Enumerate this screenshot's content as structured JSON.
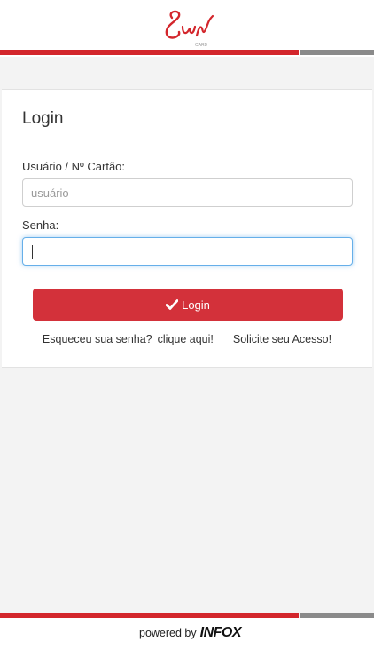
{
  "brand": {
    "name": "Sun",
    "sub": "CARD",
    "red": "#d3262c",
    "grey": "#8a8a8a"
  },
  "login": {
    "title": "Login",
    "user_label": "Usuário / Nº Cartão:",
    "user_placeholder": "usuário",
    "user_value": "",
    "password_label": "Senha:",
    "password_value": "",
    "button_label": "Login",
    "button_icon": "check-icon"
  },
  "links": {
    "forgot_text": "Esqueceu sua senha?",
    "click_here": "clique aqui!",
    "request_access": "Solicite seu Acesso!"
  },
  "footer": {
    "powered_by": "powered by",
    "vendor": "INFOX"
  }
}
